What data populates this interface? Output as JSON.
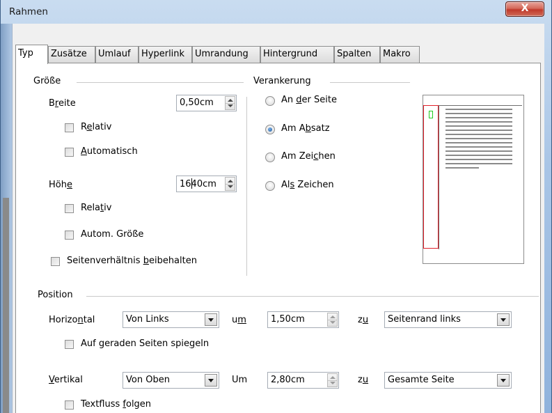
{
  "window": {
    "title": "Rahmen",
    "close_glyph": "X"
  },
  "tabs": [
    {
      "label": "Typ",
      "active": true
    },
    {
      "label": "Zusätze"
    },
    {
      "label": "Umlauf"
    },
    {
      "label": "Hyperlink"
    },
    {
      "label": "Umrandung"
    },
    {
      "label": "Hintergrund"
    },
    {
      "label": "Spalten"
    },
    {
      "label": "Makro"
    }
  ],
  "size": {
    "group_label": "Größe",
    "width": {
      "label_pre": "B",
      "label_u": "r",
      "label_post": "eite",
      "value": "0,50cm"
    },
    "width_relative": {
      "pre": "R",
      "u": "e",
      "post": "lativ",
      "checked": false
    },
    "width_auto": {
      "pre": "",
      "u": "A",
      "post": "utomatisch",
      "checked": false
    },
    "height": {
      "label_pre": "Höh",
      "label_u": "e",
      "label_post": "",
      "value_pre": "16",
      "value_post": "40cm"
    },
    "height_relative": {
      "pre": "Rela",
      "u": "t",
      "post": "iv",
      "checked": false
    },
    "height_auto": {
      "label": "Autom. Größe",
      "checked": false
    },
    "keep_ratio": {
      "pre": "Seitenverhältnis ",
      "u": "b",
      "post": "eibehalten",
      "checked": false
    }
  },
  "anchor": {
    "group_label": "Verankerung",
    "options": [
      {
        "pre": "An ",
        "u": "d",
        "post": "er Seite",
        "checked": false
      },
      {
        "pre": "Am A",
        "u": "b",
        "post": "satz",
        "checked": true
      },
      {
        "pre": "Am Zei",
        "u": "c",
        "post": "hen",
        "checked": false
      },
      {
        "pre": "Al",
        "u": "s",
        "post": " Zeichen",
        "checked": false
      }
    ]
  },
  "position": {
    "group_label": "Position",
    "horizontal": {
      "label_pre": "Horizo",
      "label_u": "n",
      "label_post": "tal",
      "select": "Von Links",
      "by_pre": "u",
      "by_u": "m",
      "by_post": "",
      "value": "1,50cm",
      "to_pre": "z",
      "to_u": "u",
      "to_post": "",
      "to_select": "Seitenrand links"
    },
    "mirror": {
      "pre": "Auf geraden Seiten spie",
      "u": "g",
      "post": "eln",
      "checked": false
    },
    "vertical": {
      "label_pre": "",
      "label_u": "V",
      "label_post": "ertikal",
      "select": "Von Oben",
      "by_label": "Um",
      "value": "2,80cm",
      "to_pre": "z",
      "to_u": "u",
      "to_post": "",
      "to_select": "Gesamte Seite"
    },
    "follow_text": {
      "pre": "Textfluss ",
      "u": "f",
      "post": "olgen",
      "checked": false
    }
  },
  "colors": {
    "preview_frame": "#e0202a",
    "preview_anchor": "#22cc22",
    "preview_lines": "#8a8a8a"
  }
}
